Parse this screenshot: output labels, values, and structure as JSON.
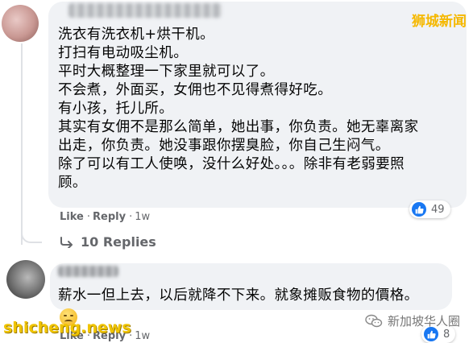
{
  "watermarks": {
    "top_right": "狮城新闻",
    "bottom_left": "shicheng.news",
    "bottom_right": "新加坡华人圈"
  },
  "comment1": {
    "lines": [
      "洗衣有洗衣机+烘干机。",
      "打扫有电动吸尘机。",
      "平时大概整理一下家里就可以了。",
      "不会煮，外面买，女佣也不见得煮得好吃。",
      "有小孩，托儿所。",
      "其实有女佣不是那么简单，她出事，你负责。她无辜离家",
      "出走，你负责。她没事跟你摆臭脸，你自己生闷气。",
      "除了可以有工人使唤，没什么好处。。。除非有老弱要照",
      "顾。"
    ],
    "like_label": "Like",
    "reply_label": "Reply",
    "time": "1w",
    "reaction_count": "49",
    "replies_label": "10 Replies"
  },
  "comment2": {
    "text": "薪水一但上去，以后就降不下来。就象摊贩食物的價格。",
    "like_label": "Like",
    "reply_label": "Reply",
    "time": "1w",
    "reaction_count": "8"
  },
  "colors": {
    "bubble": "#f0f2f5",
    "like_blue": "#1877f2",
    "meta_gray": "#65676b",
    "watermark_yellow": "#f5b800"
  }
}
